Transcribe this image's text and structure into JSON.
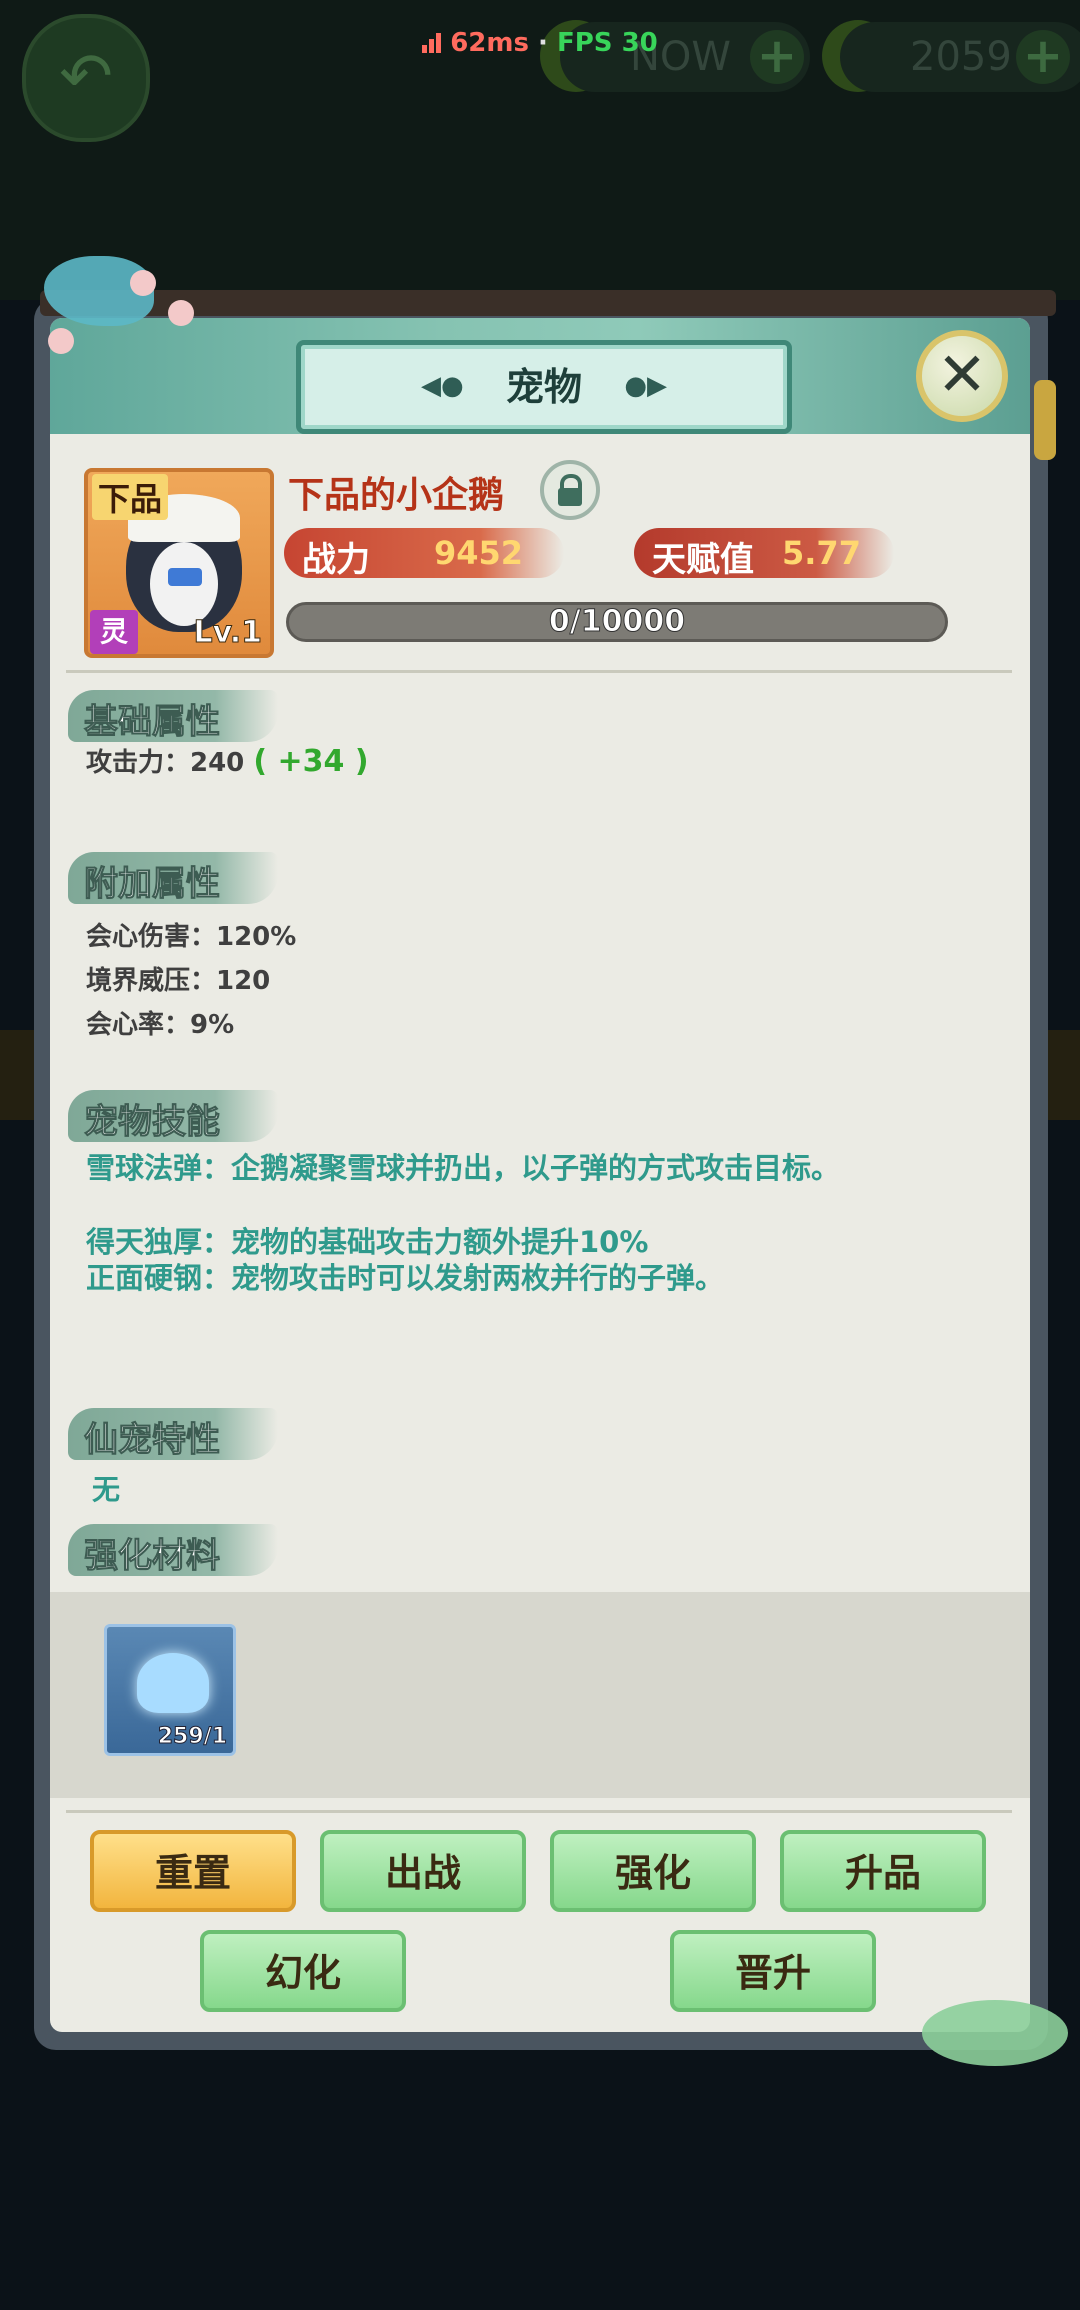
{
  "status_bar": {
    "ping": "62ms",
    "separator": "·",
    "fps": "FPS 30"
  },
  "background": {
    "resource_left": "NOW",
    "resource_right": "2059",
    "plus": "+"
  },
  "panel": {
    "title": "宠物",
    "close_label": "✕"
  },
  "pet": {
    "grade": "下品",
    "name": "下品的小企鹅",
    "type_badge": "灵",
    "level": "Lv.1",
    "power_label": "战力",
    "power_value": "9452",
    "talent_label": "天赋值",
    "talent_value": "5.77",
    "exp_text": "0/10000",
    "exp_fraction": 0
  },
  "sections": {
    "basic": {
      "title": "基础属性",
      "attack_label": "攻击力：240",
      "attack_bonus": "( +34 )"
    },
    "extra": {
      "title": "附加属性",
      "items": [
        "会心伤害：120%",
        "境界威压：120",
        "会心率：9%"
      ]
    },
    "skills": {
      "title": "宠物技能",
      "items": [
        "雪球法弹：企鹅凝聚雪球并扔出，以子弹的方式攻击目标。",
        "得天独厚：宠物的基础攻击力额外提升10%",
        "正面硬钢：宠物攻击时可以发射两枚并行的子弹。"
      ]
    },
    "traits": {
      "title": "仙宠特性",
      "value": "无"
    },
    "materials": {
      "title": "强化材料",
      "item_count": "259/1"
    }
  },
  "buttons": {
    "reset": "重置",
    "deploy": "出战",
    "enhance": "强化",
    "upgrade_grade": "升品",
    "transform": "幻化",
    "promote": "晋升"
  },
  "colors": {
    "accent_teal": "#5fa79a",
    "name_red": "#b53318",
    "skill_teal": "#2f9a8c",
    "bonus_green": "#32a82e",
    "button_green": "#86d88c",
    "button_yellow": "#f2b53e"
  },
  "icons": [
    "back-arrow-icon",
    "coin-icon",
    "plus-icon",
    "lock-icon",
    "close-icon",
    "lotus-material-icon",
    "signal-icon"
  ]
}
